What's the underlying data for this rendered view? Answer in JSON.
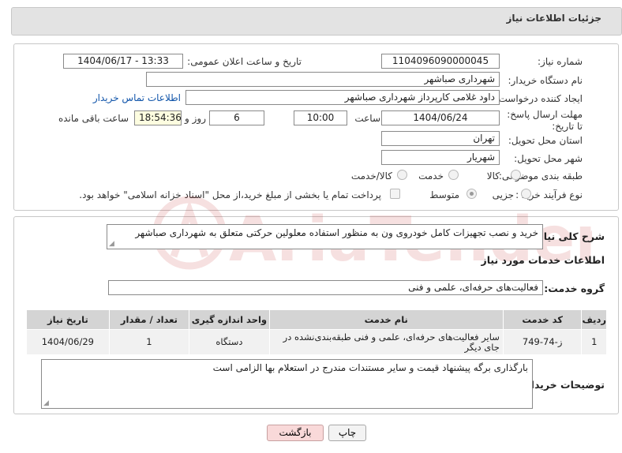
{
  "header": {
    "title": "جزئیات اطلاعات نیاز"
  },
  "form": {
    "need_number": {
      "label": "شماره نیاز:",
      "value": "1104096090000045"
    },
    "announce_datetime": {
      "label": "تاریخ و ساعت اعلان عمومی:",
      "value": "1404/06/17 - 13:33"
    },
    "buyer_org": {
      "label": "نام دستگاه خریدار:",
      "value": "شهرداری صباشهر"
    },
    "requester": {
      "label": "ایجاد کننده درخواست:",
      "value": "داود غلامی کارپرداز شهرداری صباشهر",
      "contact_link": "اطلاعات تماس خریدار"
    },
    "deadline": {
      "label": "مهلت ارسال پاسخ: تا تاریخ:",
      "date": "1404/06/24",
      "time_label": "ساعت",
      "time": "10:00",
      "days": "6",
      "days_label": "روز و",
      "remaining": "18:54:36",
      "remaining_label": "ساعت باقی مانده"
    },
    "province": {
      "label": "استان محل تحویل:",
      "value": "تهران"
    },
    "city": {
      "label": "شهر محل تحویل:",
      "value": "شهریار"
    },
    "category": {
      "label": "طبقه بندی موضوعی:",
      "options": [
        "کالا",
        "خدمت",
        "کالا/خدمت"
      ]
    },
    "purchase_type": {
      "label": "نوع فرآیند خرید :",
      "options": [
        "جزیی",
        "متوسط"
      ],
      "note": "پرداخت تمام یا بخشی از مبلغ خرید،از محل \"اسناد خزانه اسلامی\" خواهد بود."
    }
  },
  "description": {
    "label": "شرح کلی نیاز:",
    "value": "خرید و نصب تجهیزات کامل خودروی ون  به منظور استفاده معلولین حرکتی متعلق به شهرداری صباشهر"
  },
  "services": {
    "section_title": "اطلاعات خدمات مورد نیاز",
    "group_label": "گروه خدمت:",
    "group_value": "فعالیت‌های حرفه‌ای، علمی و فنی",
    "columns": [
      "ردیف",
      "کد خدمت",
      "نام خدمت",
      "واحد اندازه گیری",
      "تعداد / مقدار",
      "تاریخ نیاز"
    ],
    "rows": [
      [
        "1",
        "ز-74-749",
        "سایر فعالیت‌های حرفه‌ای، علمی و فنی طبقه‌بندی‌نشده در جای دیگر",
        "دستگاه",
        "1",
        "1404/06/29"
      ]
    ]
  },
  "buyer_notes": {
    "label": "توضیحات خریدار:",
    "value": "بارگذاری برگه پیشنهاد قیمت و سایر مستندات مندرج در استعلام بها الزامی است"
  },
  "buttons": {
    "print": "چاپ",
    "back": "بازگشت"
  },
  "colors": {
    "header_bg": "#e3e3e3",
    "link": "#1155aa",
    "back_button_bg": "#f9d9d9",
    "table_header_bg": "#d4d4d4"
  }
}
